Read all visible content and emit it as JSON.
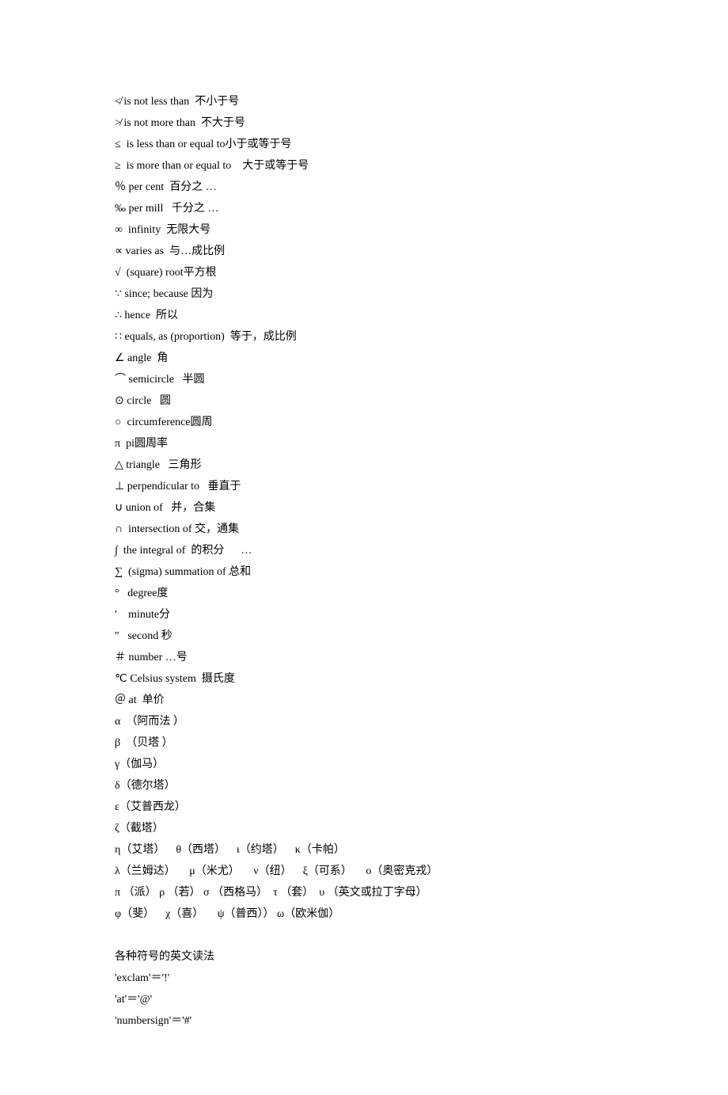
{
  "symbol_lines": [
    "≮ is not less than  不小于号",
    "≯ is not more than  不大于号",
    "≤  is less than or equal to小于或等于号",
    "≥  is more than or equal to    大于或等于号",
    "％ per cent  百分之 …",
    "‰ per mill   千分之 …",
    "∞  infinity  无限大号",
    "∝ varies as  与…成比例",
    "√  (square) root平方根",
    "∵ since; because 因为",
    "∴ hence  所以",
    "∷ equals, as (proportion)  等于，成比例",
    "∠ angle  角",
    "⌒ semicircle   半圆",
    "⊙ circle   圆",
    "○  circumference圆周",
    "π  pi圆周率",
    "△ triangle   三角形",
    "⊥ perpendicular to   垂直于",
    "∪ union of   并，合集",
    "∩  intersection of 交，通集",
    "∫  the integral of  的积分      …",
    "∑  (sigma) summation of 总和",
    "°   degree度",
    "′    minute分",
    "″   second 秒",
    "＃ number …号",
    "℃ Celsius system  摄氏度",
    "＠ at  单价",
    "α  （阿而法 ）",
    "β  （贝塔 ）",
    "γ（伽马）",
    "δ（德尔塔）",
    "ε（艾普西龙）",
    "ζ（截塔）",
    "η（艾塔）    θ（西塔）    ι（约塔）    κ（卡帕）",
    "λ（兰姆达）     μ（米尤）     ν（纽）    ξ（可系）     ο（奥密克戎）",
    "π （派） ρ （若） σ （西格马）  τ （套）  υ （英文或拉丁字母）",
    "φ（斐）    χ（喜）     ψ（普西）） ω（欧米伽）"
  ],
  "section_title": "各种符号的英文读法",
  "reading_lines": [
    "'exclam'＝'!'",
    "'at'＝'@'",
    "'numbersign'＝'#'"
  ]
}
